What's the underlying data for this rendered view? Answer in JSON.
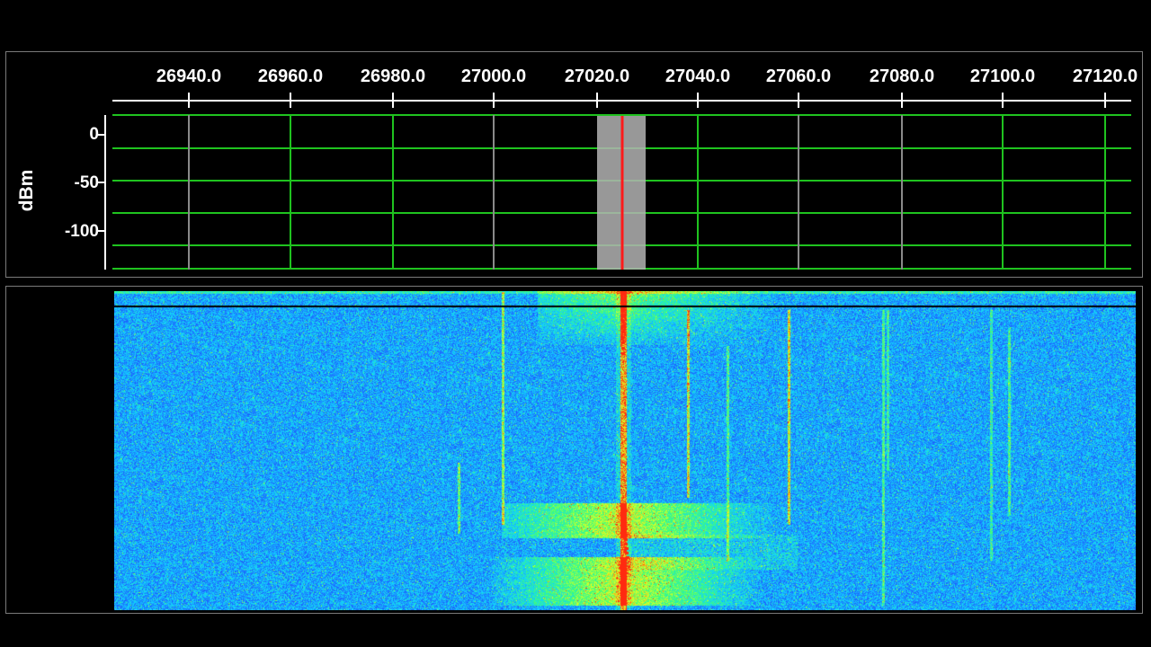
{
  "spectrum": {
    "frequency_ticks": [
      "26940.0",
      "26960.0",
      "26980.0",
      "27000.0",
      "27020.0",
      "27040.0",
      "27060.0",
      "27080.0",
      "27100.0",
      "27120.0"
    ],
    "level_ticks": [
      "0",
      "-50",
      "-100"
    ],
    "unit": "dBm"
  },
  "colors": {
    "background": "#000000",
    "grid_green": "#1fc31f",
    "grid_gray": "#8a8a8a",
    "marker_red": "#ff1a1a",
    "passband": "#b3b3b3"
  },
  "waterfall": {
    "palette": [
      "#0a1ec8",
      "#1e64ff",
      "#12d2ff",
      "#3cff7a",
      "#e6ff20",
      "#ff2a10"
    ]
  }
}
